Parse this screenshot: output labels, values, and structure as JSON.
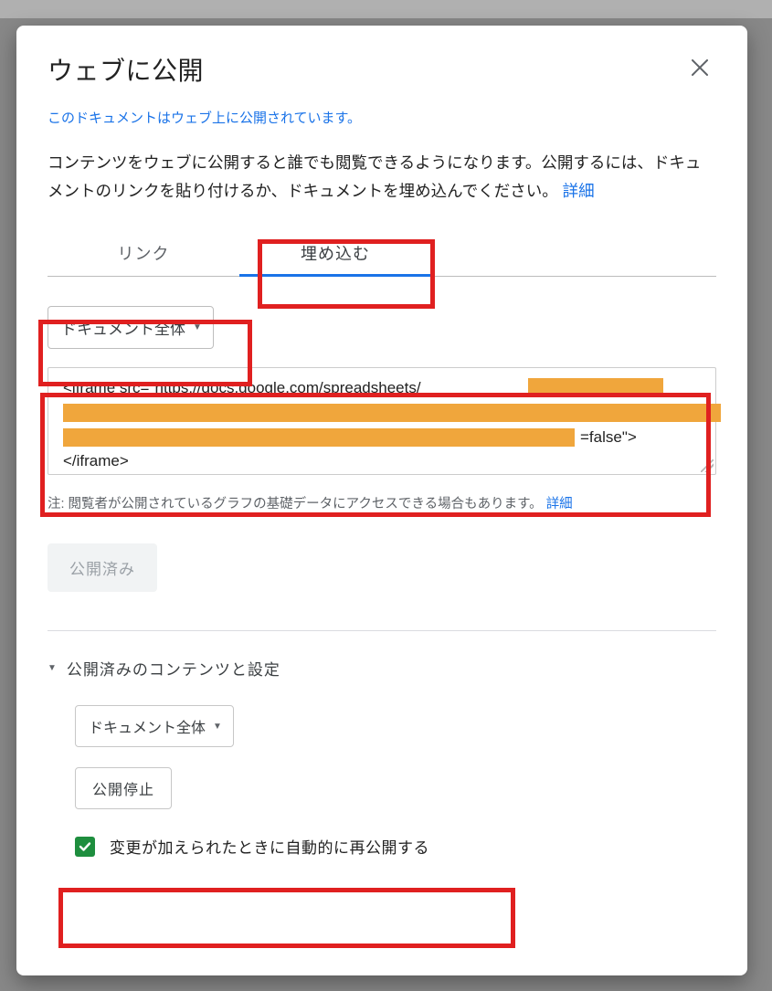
{
  "dialog": {
    "title": "ウェブに公開",
    "status_line": "このドキュメントはウェブ上に公開されています。",
    "description": "コンテンツをウェブに公開すると誰でも閲覧できるようになります。公開するには、ドキュメントのリンクを貼り付けるか、ドキュメントを埋め込んでください。",
    "learn_more": "詳細"
  },
  "tabs": {
    "link": "リンク",
    "embed": "埋め込む"
  },
  "scope_dropdown": {
    "selected": "ドキュメント全体"
  },
  "embed_code": {
    "line1": "<iframe src=\"https://docs.google.com/spreadsheets/",
    "line4_suffix": "=false\">",
    "line5": "</iframe>"
  },
  "note": {
    "text": "注: 閲覧者が公開されているグラフの基礎データにアクセスできる場合もあります。",
    "link": "詳細"
  },
  "published_button": "公開済み",
  "section": {
    "heading": "公開済みのコンテンツと設定",
    "scope_selected": "ドキュメント全体",
    "stop_publish": "公開停止",
    "auto_republish": "変更が加えられたときに自動的に再公開する"
  }
}
